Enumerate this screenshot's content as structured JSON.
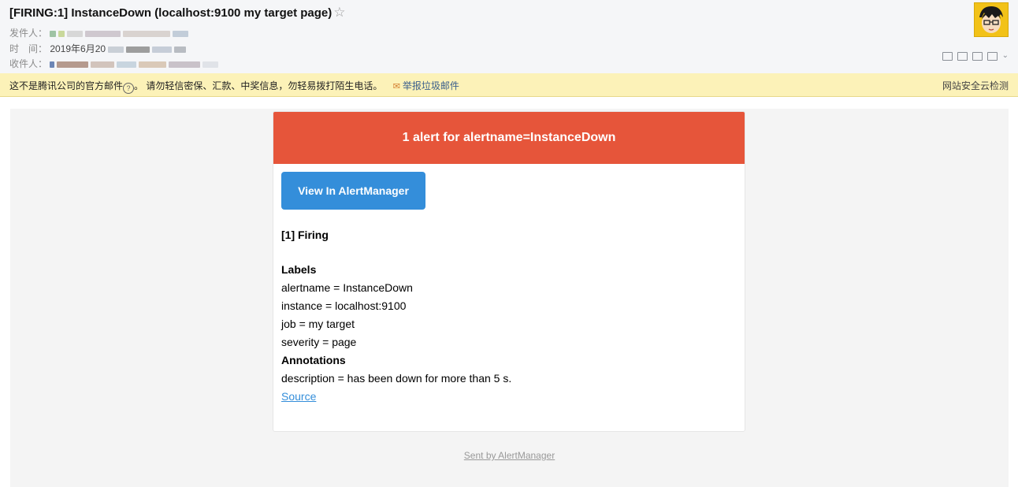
{
  "mail": {
    "subject": "[FIRING:1] InstanceDown (localhost:9100 my target page)",
    "star": "☆",
    "from_label": "发件人：",
    "time_label": "时　间：",
    "time_value": "2019年6月20",
    "to_label": "收件人："
  },
  "warning": {
    "text": "这不是腾讯公司的官方邮件",
    "help": "?",
    "text2": "。 请勿轻信密保、汇款、中奖信息，勿轻易拨打陌生电话。",
    "report_label": "举报垃圾邮件",
    "security_check": "网站安全云检测"
  },
  "alert": {
    "header": "1 alert for alertname=InstanceDown",
    "button_label": "View In AlertManager",
    "firing_title": "[1] Firing",
    "labels_title": "Labels",
    "labels": [
      "alertname = InstanceDown",
      "instance = localhost:9100",
      "job = my target",
      "severity = page"
    ],
    "annotations_title": "Annotations",
    "annotations": [
      "description = has been down for more than 5 s."
    ],
    "source_link": "Source"
  },
  "footer": {
    "text": "Sent by AlertManager"
  },
  "colors": {
    "alert_header": "#e6553a",
    "button": "#348eda",
    "warning_bg": "#fcf2b8"
  }
}
